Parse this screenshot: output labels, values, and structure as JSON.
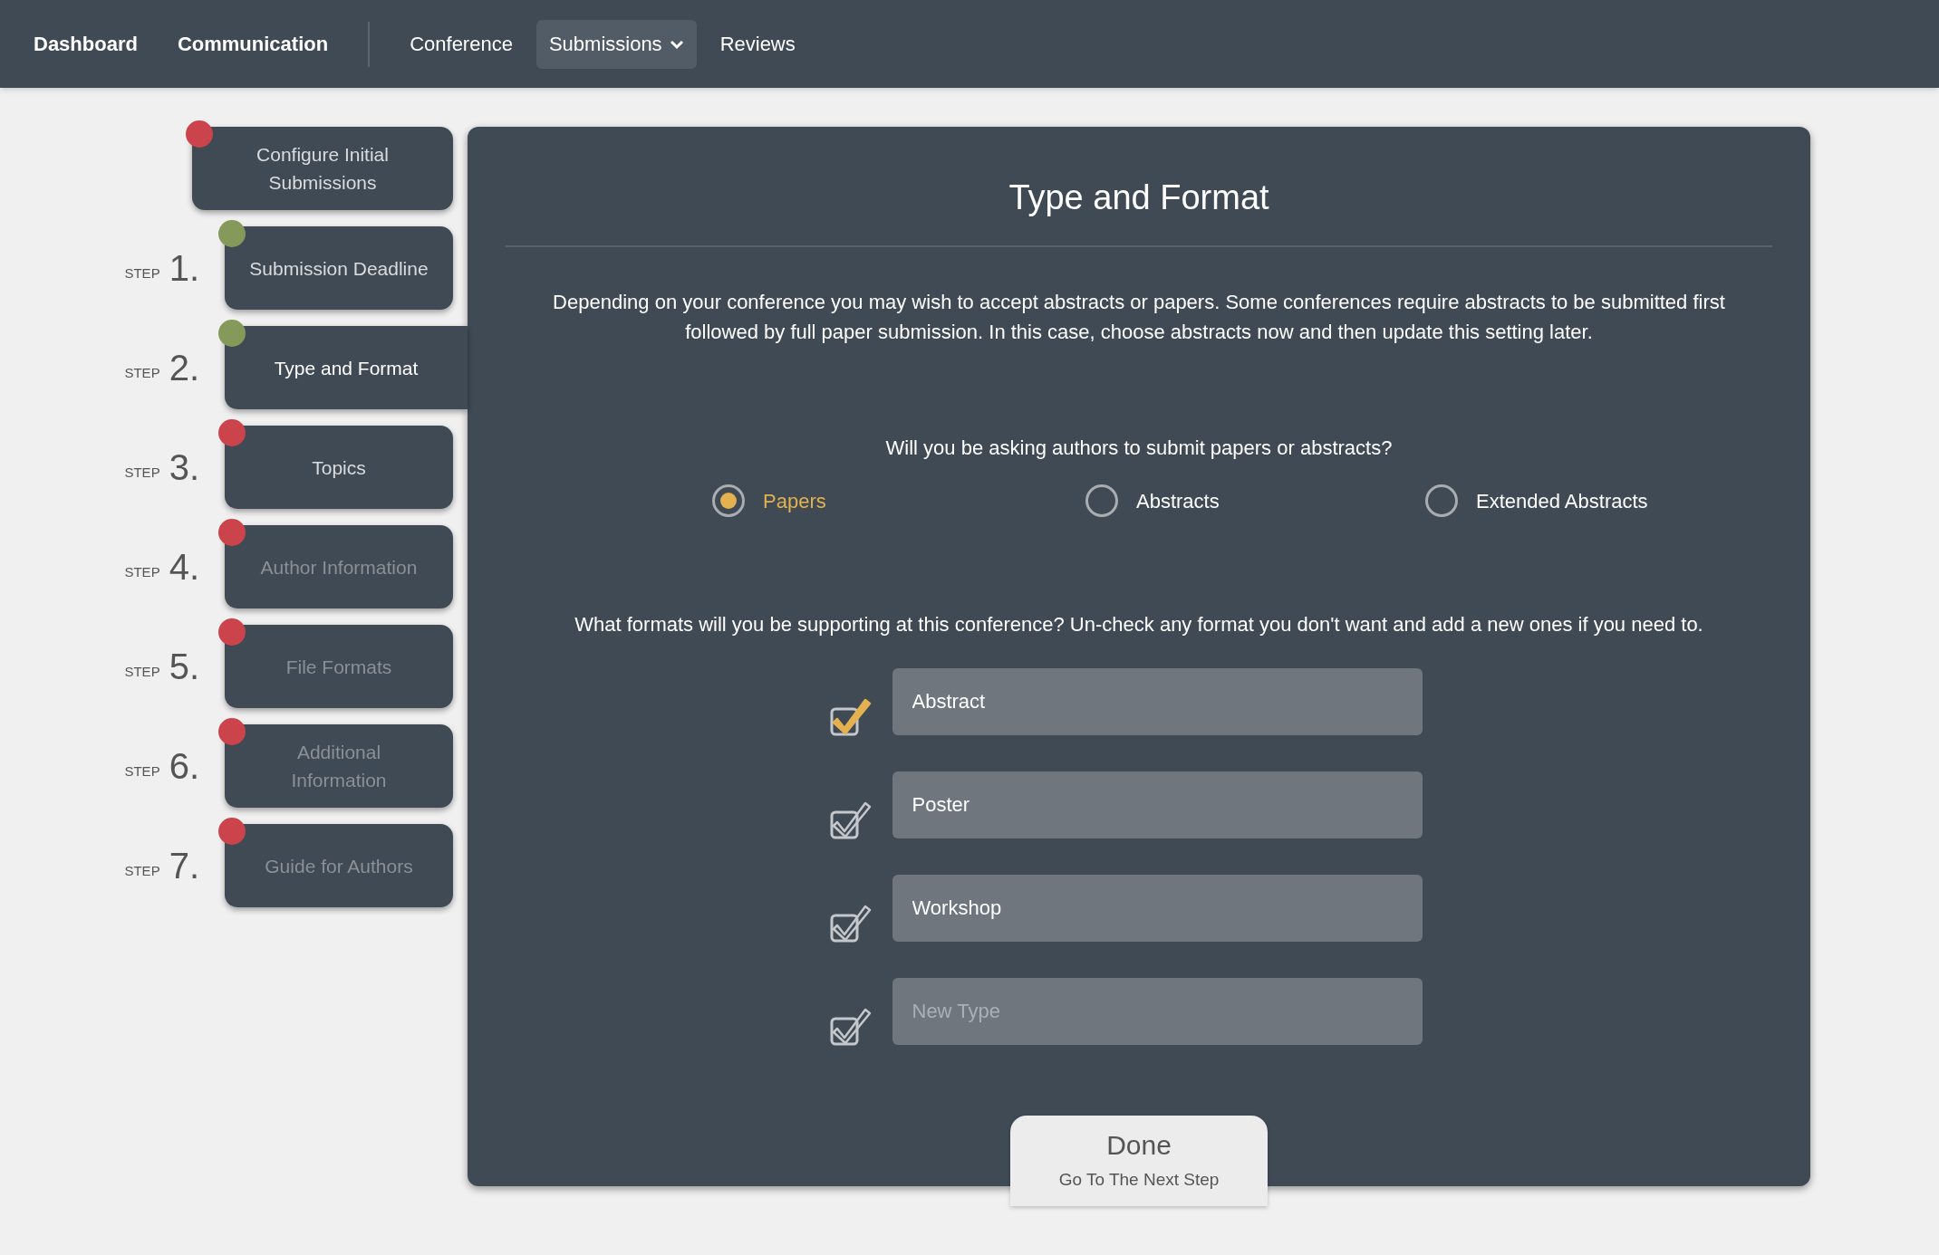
{
  "nav": {
    "primary": [
      "Dashboard",
      "Communication"
    ],
    "secondary": [
      {
        "label": "Conference",
        "selected": false,
        "has_menu": false
      },
      {
        "label": "Submissions",
        "selected": true,
        "has_menu": true
      },
      {
        "label": "Reviews",
        "selected": false,
        "has_menu": false
      }
    ]
  },
  "steps": [
    {
      "label": "Configure Initial Submissions",
      "color": "#cc444b",
      "selected": false,
      "disabled": false
    },
    {
      "step_word": "STEP",
      "number": "1.",
      "label": "Submission Deadline",
      "color": "#85995a",
      "selected": false,
      "disabled": false
    },
    {
      "step_word": "STEP",
      "number": "2.",
      "label": "Type and Format",
      "color": "#85995a",
      "selected": true,
      "disabled": false
    },
    {
      "step_word": "STEP",
      "number": "3.",
      "label": "Topics",
      "color": "#cc444b",
      "selected": false,
      "disabled": false
    },
    {
      "step_word": "STEP",
      "number": "4.",
      "label": "Author Information",
      "color": "#cc444b",
      "selected": false,
      "disabled": true
    },
    {
      "step_word": "STEP",
      "number": "5.",
      "label": "File Formats",
      "color": "#cc444b",
      "selected": false,
      "disabled": true
    },
    {
      "step_word": "STEP",
      "number": "6.",
      "label": "Additional Information",
      "color": "#cc444b",
      "selected": false,
      "disabled": true
    },
    {
      "step_word": "STEP",
      "number": "7.",
      "label": "Guide for Authors",
      "color": "#cc444b",
      "selected": false,
      "disabled": true
    }
  ],
  "panel": {
    "title": "Type and Format",
    "intro": "Depending on your conference you may wish to accept abstracts or papers. Some conferences require abstracts to be submitted first followed by full paper submission. In this case, choose abstracts now and then update this setting later.",
    "question": "Will you be asking authors to submit papers or abstracts?",
    "options": [
      {
        "label": "Papers",
        "selected": true
      },
      {
        "label": "Abstracts",
        "selected": false
      },
      {
        "label": "Extended Abstracts",
        "selected": false
      }
    ],
    "formats_question": "What formats will you be supporting at this conference? Un-check any format you don't want and add a new ones if you need to.",
    "formats": [
      {
        "value": "Abstract",
        "checked": true
      },
      {
        "value": "Poster",
        "checked": false
      },
      {
        "value": "Workshop",
        "checked": false
      },
      {
        "placeholder": "New Type",
        "checked": false
      }
    ],
    "done": {
      "label": "Done",
      "sublabel": "Go To The Next Step"
    }
  }
}
